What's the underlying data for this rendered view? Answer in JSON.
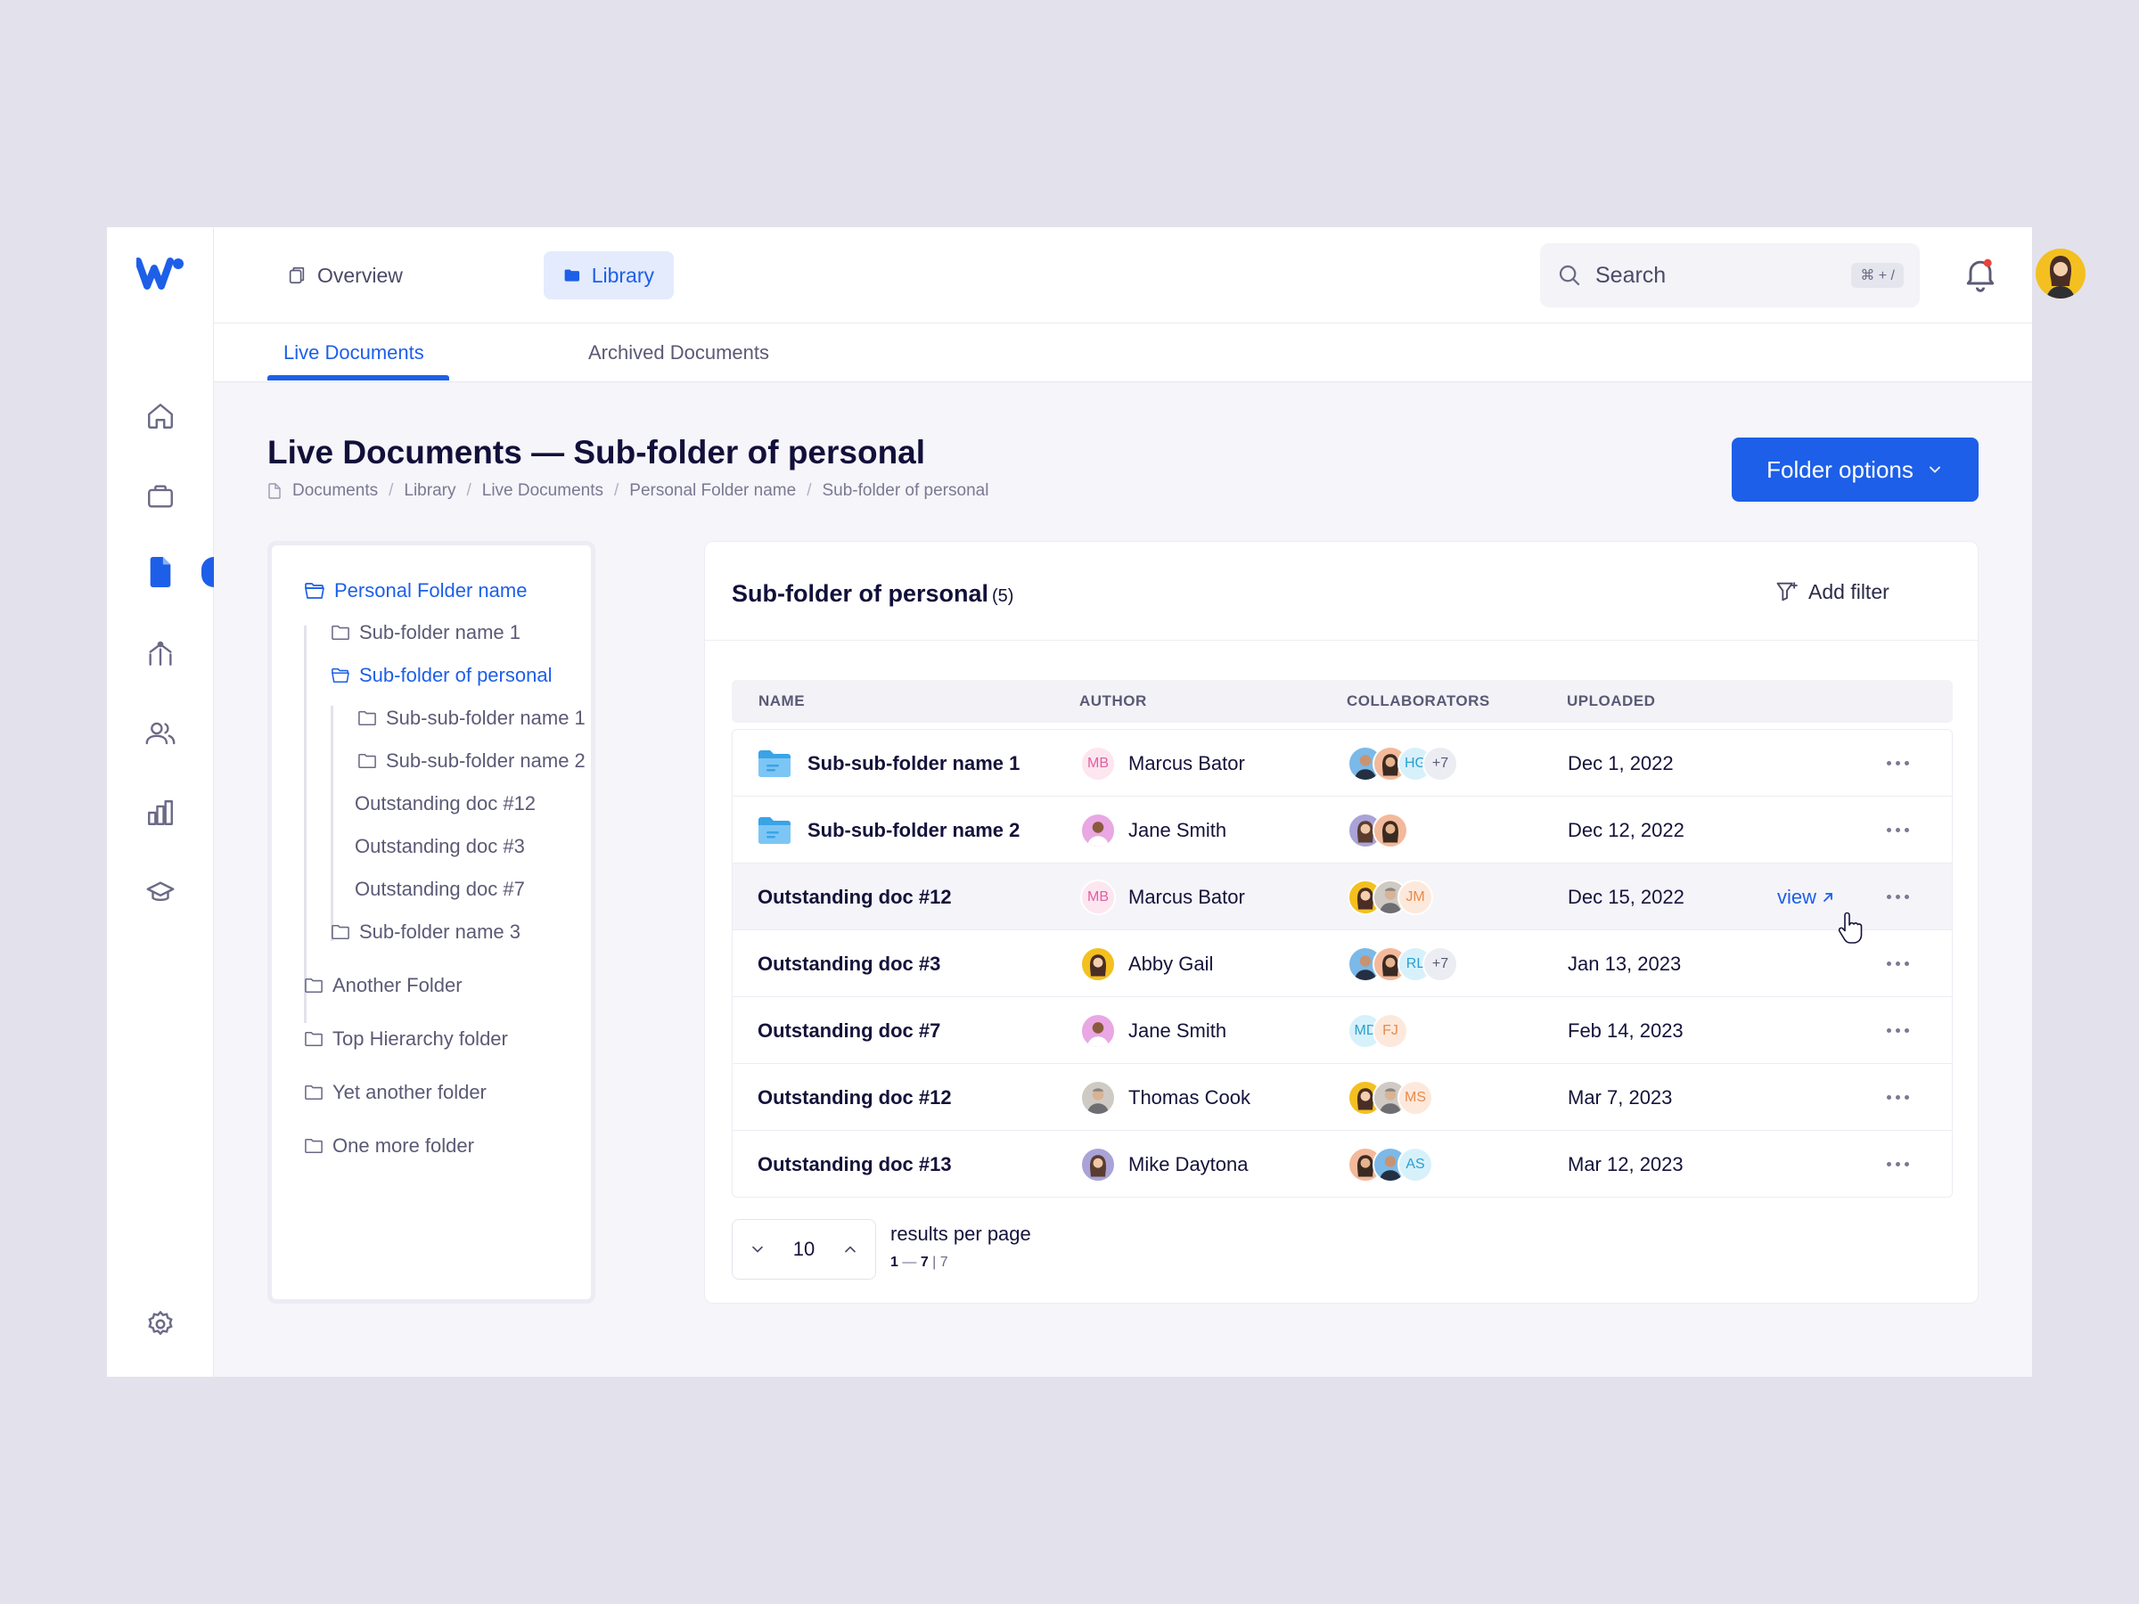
{
  "top_nav": {
    "tabs": [
      {
        "label": "Overview",
        "icon": "copy-icon",
        "active": false
      },
      {
        "label": "Library",
        "icon": "folder-icon",
        "active": true
      }
    ]
  },
  "search": {
    "placeholder": "Search",
    "shortcut": "⌘ + /"
  },
  "sub_tabs": [
    {
      "label": "Live Documents",
      "active": true
    },
    {
      "label": "Archived Documents",
      "active": false
    }
  ],
  "page": {
    "title": "Live Documents — Sub-folder of personal",
    "breadcrumb": [
      "Documents",
      "Library",
      "Live Documents",
      "Personal Folder name",
      "Sub-folder of personal"
    ],
    "folder_options_label": "Folder options"
  },
  "tree": {
    "root": "Personal Folder name",
    "items": [
      {
        "label": "Sub-folder name 1",
        "type": "folder"
      },
      {
        "label": "Sub-folder of personal",
        "type": "folder-open",
        "active": true
      },
      {
        "label": "Sub-sub-folder name 1",
        "type": "folder"
      },
      {
        "label": "Sub-sub-folder name 2",
        "type": "folder"
      },
      {
        "label": "Outstanding doc #12",
        "type": "doc"
      },
      {
        "label": "Outstanding doc #3",
        "type": "doc"
      },
      {
        "label": "Outstanding doc #7",
        "type": "doc"
      },
      {
        "label": "Sub-folder name 3",
        "type": "folder"
      }
    ],
    "top_level": [
      "Another Folder",
      "Top Hierarchy folder",
      "Yet another folder",
      "One more folder"
    ]
  },
  "table": {
    "title": "Sub-folder of personal",
    "count": "(5)",
    "add_filter_label": "Add filter",
    "columns": [
      "NAME",
      "AUTHOR",
      "COLLABORATORS",
      "UPLOADED"
    ],
    "view_label": "view",
    "rows": [
      {
        "name": "Sub-sub-folder name 1",
        "folder": true,
        "author": "Marcus Bator",
        "author_initials": "MB",
        "date": "Dec 1, 2022",
        "collab_initials": "HG",
        "collab_more": "+7"
      },
      {
        "name": "Sub-sub-folder name 2",
        "folder": true,
        "author": "Jane Smith",
        "author_initials": "",
        "date": "Dec 12, 2022",
        "collab_initials": "",
        "collab_more": ""
      },
      {
        "name": "Outstanding doc #12",
        "folder": false,
        "author": "Marcus Bator",
        "author_initials": "MB",
        "date": "Dec 15, 2022",
        "collab_initials": "JM",
        "collab_more": ""
      },
      {
        "name": "Outstanding doc #3",
        "folder": false,
        "author": "Abby Gail",
        "author_initials": "",
        "date": "Jan 13, 2023",
        "collab_initials": "RL",
        "collab_more": "+7"
      },
      {
        "name": "Outstanding doc #7",
        "folder": false,
        "author": "Jane Smith",
        "author_initials": "",
        "date": "Feb 14, 2023",
        "collab_initials": "MD",
        "collab_initials_2": "FJ",
        "collab_more": ""
      },
      {
        "name": "Outstanding doc #12",
        "folder": false,
        "author": "Thomas Cook",
        "author_initials": "",
        "date": "Mar 7, 2023",
        "collab_initials": "MS",
        "collab_more": ""
      },
      {
        "name": "Outstanding doc #13",
        "folder": false,
        "author": "Mike Daytona",
        "author_initials": "",
        "date": "Mar 12, 2023",
        "collab_initials": "AS",
        "collab_more": ""
      }
    ]
  },
  "pagination": {
    "per_page": "10",
    "label": "results per page",
    "range_start": "1",
    "range_sep": "—",
    "range_end": "7",
    "divider": "|",
    "total": "7"
  },
  "colors": {
    "accent": "#1d5fe8",
    "background": "#f5f5fa"
  }
}
